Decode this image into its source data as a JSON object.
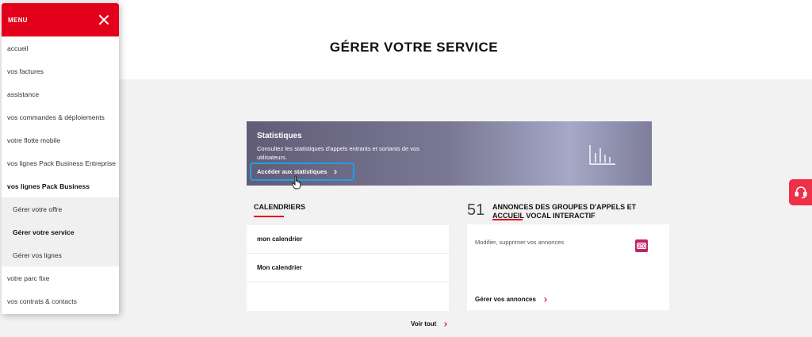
{
  "menu": {
    "title": "MENU",
    "items": [
      {
        "label": "accueil"
      },
      {
        "label": "vos factures"
      },
      {
        "label": "assistance"
      },
      {
        "label": "vos commandes & déploiements"
      },
      {
        "label": "votre flotte mobile"
      },
      {
        "label": "vos lignes Pack Business Entreprise"
      },
      {
        "label": "vos lignes Pack Business"
      },
      {
        "label": "Gérer votre offre"
      },
      {
        "label": "Gérer votre service"
      },
      {
        "label": "Gérer vos lignes"
      },
      {
        "label": "votre parc fixe"
      },
      {
        "label": "vos contrats & contacts"
      }
    ]
  },
  "page": {
    "title": "GÉRER VOTRE SERVICE"
  },
  "stats": {
    "title": "Statistiques",
    "description": "Consultez les statistiques d'appels entrants et sortants de vos utilisateurs.",
    "link": "Accéder aux statistiques"
  },
  "calendars": {
    "title": "CALENDRIERS",
    "rows": [
      {
        "label": "mon calendrier"
      },
      {
        "label": "Mon calendrier"
      }
    ],
    "see_all": "Voir tout"
  },
  "announcements": {
    "count": "51",
    "title": "ANNONCES DES GROUPES D'APPELS ET ACCUEIL VOCAL INTERACTIF",
    "description": "Modifier, supprimer vos annonces",
    "link": "Gérer vos annonces"
  },
  "colors": {
    "brand_red": "#e2001a",
    "focus_blue": "#1ea0e6",
    "voicemail_magenta": "#c0226b"
  },
  "icons": [
    "close-icon",
    "bar-chart-icon",
    "hand-pointer-icon",
    "voicemail-icon",
    "headset-icon",
    "chevron-right-icon"
  ]
}
